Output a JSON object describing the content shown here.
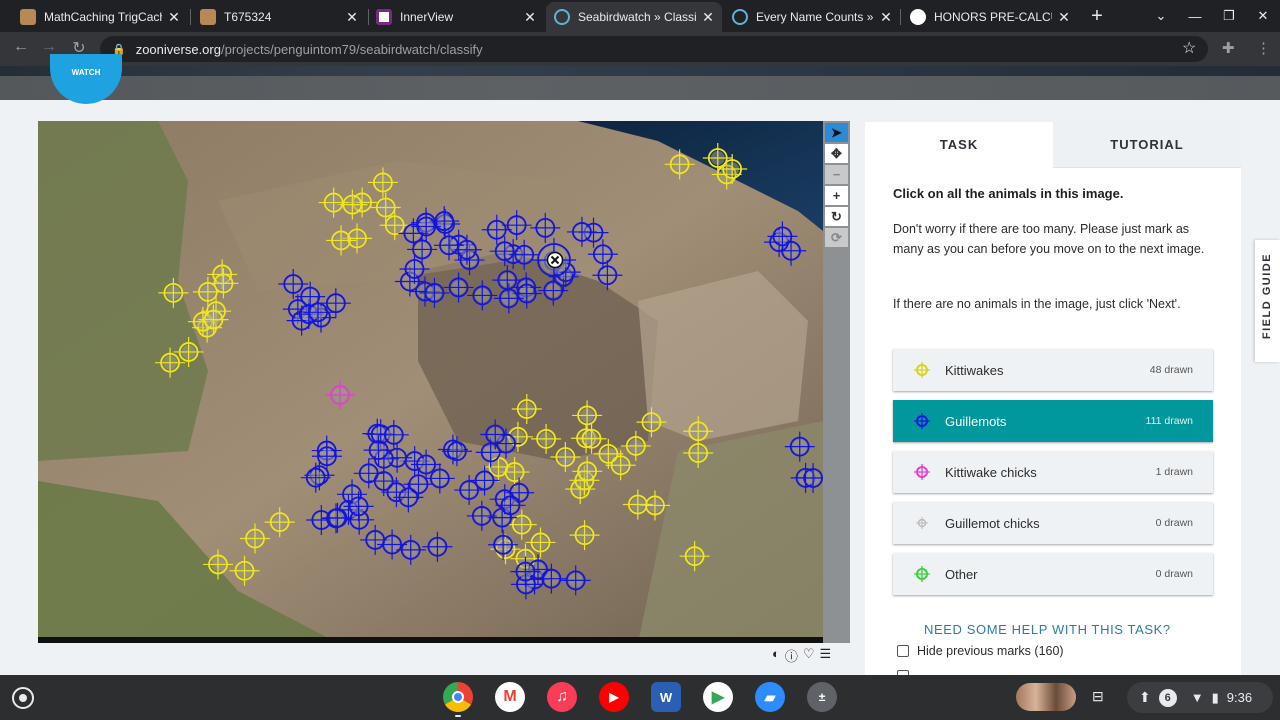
{
  "browser": {
    "tabs": [
      {
        "title": "MathCaching TrigCach",
        "icon": "mathcaching-favicon",
        "color": "#b58a57"
      },
      {
        "title": "T675324",
        "icon": "document-favicon",
        "color": "#b58a57"
      },
      {
        "title": "InnerView",
        "icon": "innerview-favicon",
        "color": "#ffffff"
      },
      {
        "title": "Seabirdwatch » Classif",
        "icon": "zooniverse-favicon",
        "color": "#5fb3d6"
      },
      {
        "title": "Every Name Counts » C",
        "icon": "zooniverse-favicon",
        "color": "#5fb3d6"
      },
      {
        "title": "HONORS PRE-CALCULU",
        "icon": "schoology-favicon",
        "color": "#ffffff"
      }
    ],
    "new_tab_label": "+",
    "url_host": "zooniverse.org",
    "url_path": "/projects/penguintom79/seabirdwatch/classify"
  },
  "site": {
    "logo_text": "WATCH"
  },
  "viewer": {
    "tools": [
      "pointer-icon",
      "pan-icon",
      "zoom-out-icon",
      "zoom-in-icon",
      "rotate-icon",
      "reset-icon"
    ],
    "subject_tools": [
      "invert-icon",
      "info-icon",
      "favorite-icon",
      "collections-icon"
    ]
  },
  "panel": {
    "tab_task": "TASK",
    "tab_tutorial": "TUTORIAL",
    "question": "Click on all the animals in this image.",
    "help_1": "Don't worry if there are too many. Please just mark as many as you can before you move on to the next image.",
    "help_2": "If there are no animals in the image, just click 'Next'.",
    "choices": [
      {
        "label": "Kittiwakes",
        "count": "48 drawn",
        "color": "#d9d21a",
        "icon": "crosshair-icon"
      },
      {
        "label": "Guillemots",
        "count": "111 drawn",
        "color": "#1a1ad9",
        "icon": "crosshair-icon"
      },
      {
        "label": "Kittiwake chicks",
        "count": "1 drawn",
        "color": "#e23fd6",
        "icon": "crosshair-icon"
      },
      {
        "label": "Guillemot chicks",
        "count": "0 drawn",
        "color": "#bbbbbb",
        "icon": "crosshair-icon"
      },
      {
        "label": "Other",
        "count": "0 drawn",
        "color": "#3ad13a",
        "icon": "crosshair-icon"
      }
    ],
    "need_help": "NEED SOME HELP WITH THIS TASK?",
    "hide_marks": "Hide previous marks (160)",
    "field_guide": "FIELD GUIDE"
  },
  "shelf": {
    "apps": [
      {
        "name": "chrome",
        "color": "#e8453c"
      },
      {
        "name": "gmail",
        "color": "#ffffff"
      },
      {
        "name": "itunes",
        "color": "#fb3c57"
      },
      {
        "name": "youtube",
        "color": "#ff0000"
      },
      {
        "name": "word",
        "color": "#2b5fb4"
      },
      {
        "name": "play-store",
        "color": "#ffffff"
      },
      {
        "name": "zoom",
        "color": "#2d8cff"
      },
      {
        "name": "calculator",
        "color": "#5f6368"
      }
    ],
    "notification_count": "6",
    "time": "9:36"
  },
  "marks": {
    "kittiwake_color": "#f0e61c",
    "guillemot_color": "#1414e0",
    "chick_color": "#e23fd6"
  }
}
